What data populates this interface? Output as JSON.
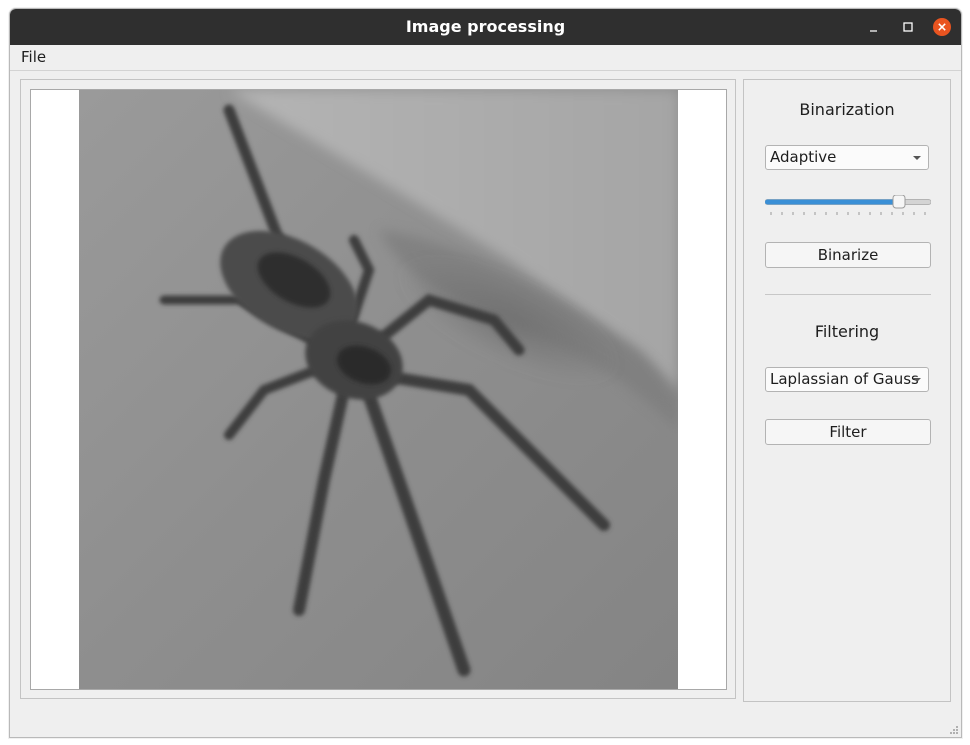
{
  "window": {
    "title": "Image processing"
  },
  "menubar": {
    "items": [
      {
        "label": "File"
      }
    ]
  },
  "binarization": {
    "title": "Binarization",
    "method": "Adaptive",
    "threshold_fraction": 0.83,
    "button_label": "Binarize"
  },
  "filtering": {
    "title": "Filtering",
    "method": "Laplassian of Gauss",
    "button_label": "Filter"
  },
  "colors": {
    "titlebar": "#2f2f2f",
    "close_button": "#e95420",
    "slider_fill": "#3a8fd6"
  }
}
